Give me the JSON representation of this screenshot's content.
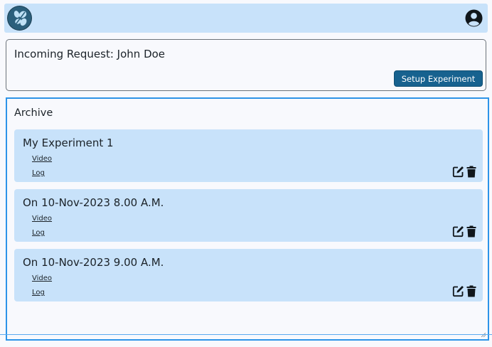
{
  "header": {
    "logo_icon": "bee-logo-icon",
    "account_icon": "account-circle-icon"
  },
  "request": {
    "title": "Incoming Request: John Doe",
    "setup_button_label": "Setup Experiment"
  },
  "archive": {
    "title": "Archive",
    "items": [
      {
        "title": "My Experiment 1",
        "video_label": "Video",
        "log_label": "Log"
      },
      {
        "title": "On 10-Nov-2023 8.00 A.M.",
        "video_label": "Video",
        "log_label": "Log"
      },
      {
        "title": "On 10-Nov-2023 9.00 A.M.",
        "video_label": "Video",
        "log_label": "Log"
      }
    ]
  },
  "colors": {
    "accent": "#17628f",
    "panel": "#c8e2fa",
    "selection": "#2d94e8"
  }
}
